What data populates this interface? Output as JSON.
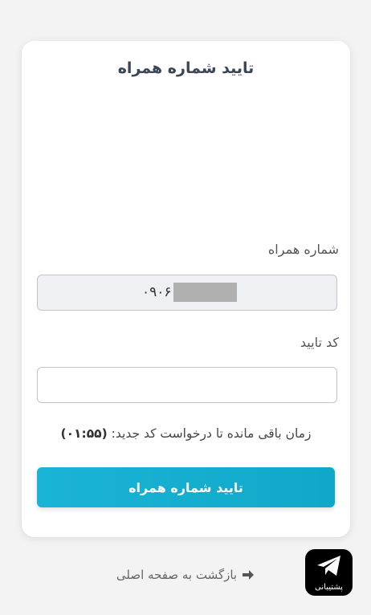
{
  "card": {
    "title": "تایید شماره همراه"
  },
  "phone": {
    "label": "شماره همراه",
    "value": "۰۹۰۶"
  },
  "code": {
    "label": "کد تایید",
    "value": ""
  },
  "timer": {
    "text": "زمان باقی مانده تا درخواست کد جدید:",
    "value": "(۰۱:۵۵)"
  },
  "submit": {
    "label": "تایید شماره همراه"
  },
  "back": {
    "label": "بازگشت به صفحه اصلی",
    "icon": "arrow-right-icon"
  },
  "support": {
    "label": "پشتیبانی",
    "icon": "telegram-icon"
  },
  "colors": {
    "accent": "#1ab4d6",
    "background": "#f3f3f3"
  }
}
